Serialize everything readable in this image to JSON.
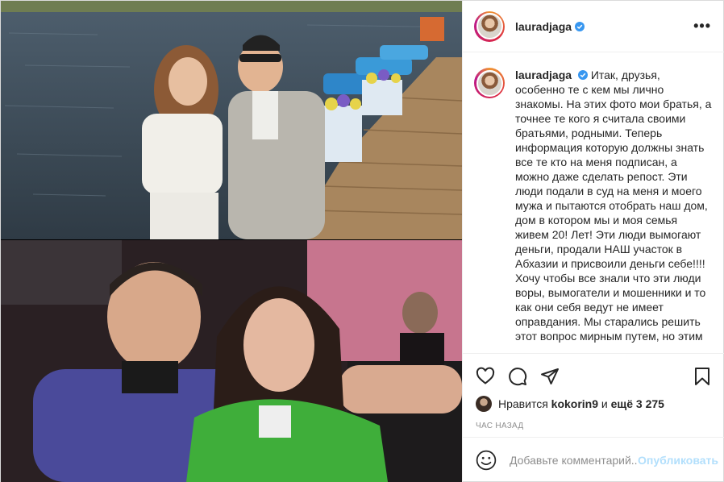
{
  "header": {
    "username": "lauradjaga",
    "avatar_icon": "profile-avatar",
    "verified_icon": "verified-badge-icon",
    "more_label": "•••"
  },
  "caption": {
    "username": "lauradjaga",
    "text": "Итак, друзья, особенно те с кем мы лично знакомы. На этих фото мои братья, а точнее те кого я считала своими братьями, родными. Теперь информация которую должны знать все те кто на меня подписан, а можно даже сделать репост. Эти люди подали в суд на меня и моего мужа и пытаются отобрать наш дом, дом в котором мы и моя семья живем 20! Лет! Эти люди вымогают деньги, продали НАШ участок в Абхазии и присвоили деньги себе!!!! Хочу чтобы все знали что эти люди воры, вымогатели и мошенники и то как они себя ведут не имеет оправдания. Мы старались решить этот вопрос мирным путем, но этим"
  },
  "actions": {
    "like_icon": "heart-icon",
    "comment_icon": "comment-icon",
    "share_icon": "share-icon",
    "save_icon": "bookmark-icon"
  },
  "likes": {
    "prefix": "Нравится",
    "user": "kokorin9",
    "connector": "и",
    "others": "ещё 3 275"
  },
  "timestamp": "час назад",
  "comment_box": {
    "emoji_icon": "emoji-icon",
    "placeholder": "Добавьте комментарий...",
    "publish_label": "Опубликовать"
  },
  "colors": {
    "verified": "#3897f0",
    "link_disabled": "#b2dffc",
    "text": "#262626",
    "muted": "#8e8e8e",
    "border": "#efefef"
  }
}
